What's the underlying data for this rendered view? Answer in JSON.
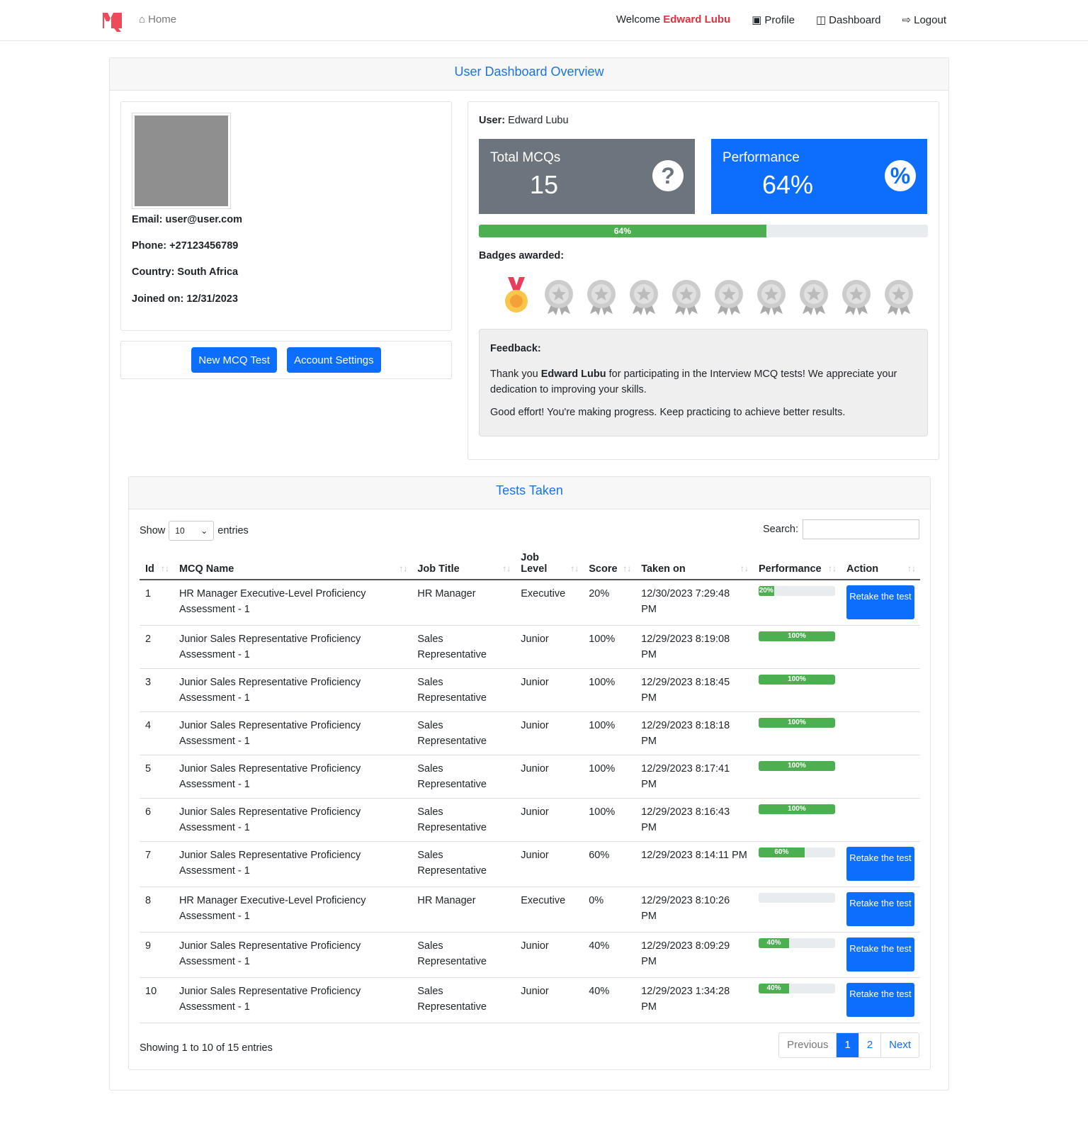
{
  "nav": {
    "home": "Home",
    "welcome": "Welcome",
    "user": "Edward Lubu",
    "profile": "Profile",
    "dashboard": "Dashboard",
    "logout": "Logout"
  },
  "title": "User Dashboard Overview",
  "profile": {
    "email": "Email: user@user.com",
    "phone": "Phone: +27123456789",
    "country": "Country: South Africa",
    "joined": "Joined on: 12/31/2023",
    "new_test": "New MCQ Test",
    "settings": "Account Settings"
  },
  "stats": {
    "user_label": "User:",
    "user": "Edward Lubu",
    "total_label": "Total MCQs",
    "total": "15",
    "perf_label": "Performance",
    "perf": "64%",
    "progress": "64%",
    "progress_value": 64,
    "badges_label": "Badges awarded:"
  },
  "feedback": {
    "title": "Feedback:",
    "p1a": "Thank you ",
    "p1b": "Edward Lubu",
    "p1c": " for participating in the Interview MCQ tests! We appreciate your dedication to improving your skills.",
    "p2": "Good effort! You're making progress. Keep practicing to achieve better results."
  },
  "tests": {
    "title": "Tests Taken",
    "show": "Show",
    "entries": "entries",
    "page_size": "10",
    "search": "Search:",
    "columns": [
      "Id",
      "MCQ Name",
      "Job Title",
      "Job Level",
      "Score",
      "Taken on",
      "Performance",
      "Action"
    ],
    "retake": "Retake the test",
    "rows": [
      [
        "1",
        "HR Manager Executive-Level Proficiency Assessment - 1",
        "HR Manager",
        "Executive",
        "20%",
        "12/30/2023 7:29:48 PM",
        20
      ],
      [
        "2",
        "Junior Sales Representative Proficiency Assessment - 1",
        "Sales Representative",
        "Junior",
        "100%",
        "12/29/2023 8:19:08 PM",
        100
      ],
      [
        "3",
        "Junior Sales Representative Proficiency Assessment - 1",
        "Sales Representative",
        "Junior",
        "100%",
        "12/29/2023 8:18:45 PM",
        100
      ],
      [
        "4",
        "Junior Sales Representative Proficiency Assessment - 1",
        "Sales Representative",
        "Junior",
        "100%",
        "12/29/2023 8:18:18 PM",
        100
      ],
      [
        "5",
        "Junior Sales Representative Proficiency Assessment - 1",
        "Sales Representative",
        "Junior",
        "100%",
        "12/29/2023 8:17:41 PM",
        100
      ],
      [
        "6",
        "Junior Sales Representative Proficiency Assessment - 1",
        "Sales Representative",
        "Junior",
        "100%",
        "12/29/2023 8:16:43 PM",
        100
      ],
      [
        "7",
        "Junior Sales Representative Proficiency Assessment - 1",
        "Sales Representative",
        "Junior",
        "60%",
        "12/29/2023 8:14:11 PM",
        60
      ],
      [
        "8",
        "HR Manager Executive-Level Proficiency Assessment - 1",
        "HR Manager",
        "Executive",
        "0%",
        "12/29/2023 8:10:26 PM",
        0
      ],
      [
        "9",
        "Junior Sales Representative Proficiency Assessment - 1",
        "Sales Representative",
        "Junior",
        "40%",
        "12/29/2023 8:09:29 PM",
        40
      ],
      [
        "10",
        "Junior Sales Representative Proficiency Assessment - 1",
        "Sales Representative",
        "Junior",
        "40%",
        "12/29/2023 1:34:28 PM",
        40
      ]
    ],
    "info": "Showing 1 to 10 of 15 entries",
    "pagination": {
      "prev": "Previous",
      "p1": "1",
      "p2": "2",
      "next": "Next"
    }
  }
}
